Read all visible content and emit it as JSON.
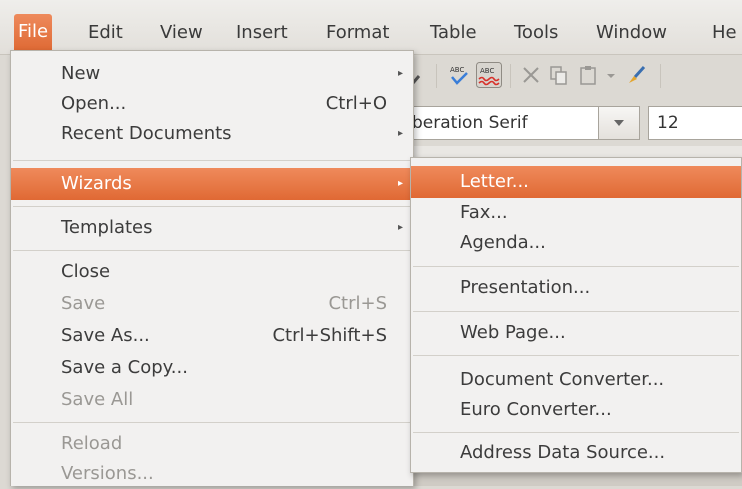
{
  "menubar": {
    "items": [
      "File",
      "Edit",
      "View",
      "Insert",
      "Format",
      "Table",
      "Tools",
      "Window",
      "He"
    ]
  },
  "toolbar": {
    "font_name": "beration Serif",
    "font_size": "12",
    "icons": [
      "find-icon",
      "spellcheck-icon",
      "autospellcheck-icon",
      "cut-icon",
      "copy-icon",
      "paste-icon",
      "dropdown-icon",
      "clone-format-icon"
    ]
  },
  "file_menu": {
    "new": "New",
    "open": "Open...",
    "open_accel": "Ctrl+O",
    "recent": "Recent Documents",
    "wizards": "Wizards",
    "templates": "Templates",
    "close": "Close",
    "save": "Save",
    "save_accel": "Ctrl+S",
    "save_as": "Save As...",
    "save_as_accel": "Ctrl+Shift+S",
    "save_copy": "Save a Copy...",
    "save_all": "Save All",
    "reload": "Reload",
    "versions": "Versions..."
  },
  "wizards_menu": {
    "letter": "Letter...",
    "fax": "Fax...",
    "agenda": "Agenda...",
    "presentation": "Presentation...",
    "web_page": "Web Page...",
    "doc_converter": "Document Converter...",
    "euro_converter": "Euro Converter...",
    "address_source": "Address Data Source..."
  },
  "colors": {
    "highlight": "#e8743f",
    "menu_bg": "#f2f1f0",
    "disabled_text": "#9a9894"
  }
}
